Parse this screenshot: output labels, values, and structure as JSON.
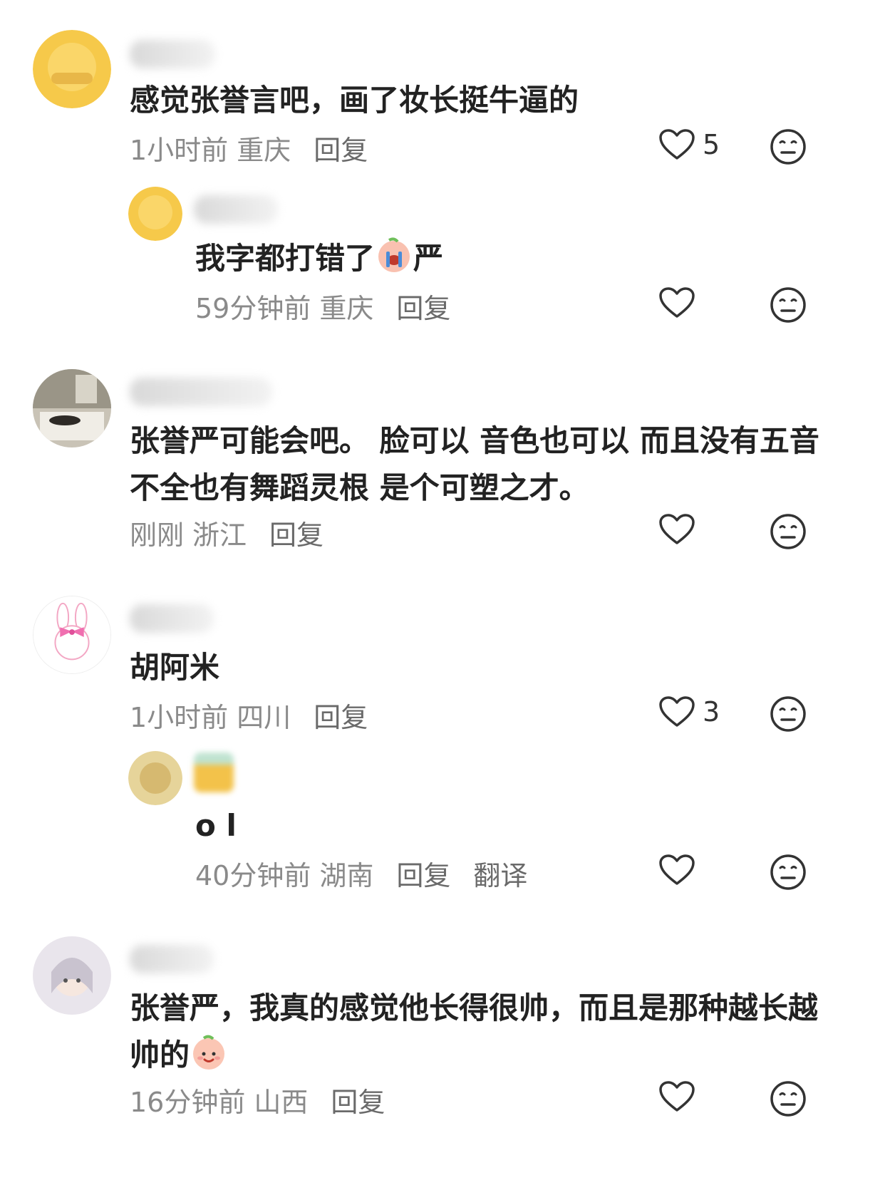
{
  "comments": [
    {
      "text": "感觉张誉言吧，画了妆长挺牛逼的",
      "time": "1小时前",
      "location": "重庆",
      "reply_label": "回复",
      "likes": "5"
    },
    {
      "text_before_emoji": "我字都打错了",
      "emoji": "crying-face-emoji",
      "text_after_emoji": "严",
      "time": "59分钟前",
      "location": "重庆",
      "reply_label": "回复",
      "likes": ""
    },
    {
      "text_line1": "张誉严可能会吧。 脸可以 音色也可以 而且没有五音",
      "text_line2": "不全也有舞蹈灵根 是个可塑之才。",
      "time": "刚刚",
      "location": "浙江",
      "reply_label": "回复",
      "likes": ""
    },
    {
      "text": "胡阿米",
      "time": "1小时前",
      "location": "四川",
      "reply_label": "回复",
      "likes": "3"
    },
    {
      "text": "o l",
      "time": "40分钟前",
      "location": "湖南",
      "reply_label": "回复",
      "translate_label": "翻译",
      "likes": ""
    },
    {
      "text_line1": "张誉严，我真的感觉他长得很帅，而且是那种越长越",
      "text_line2_before_emoji": "帅的",
      "emoji": "smiling-face-emoji",
      "time": "16分钟前",
      "location": "山西",
      "reply_label": "回复",
      "likes": ""
    }
  ],
  "icons": {
    "like": "heart-outline-icon",
    "dislike": "neutral-face-icon"
  },
  "colors": {
    "text": "#222222",
    "meta": "#8a8a8a",
    "icon": "#333333"
  }
}
